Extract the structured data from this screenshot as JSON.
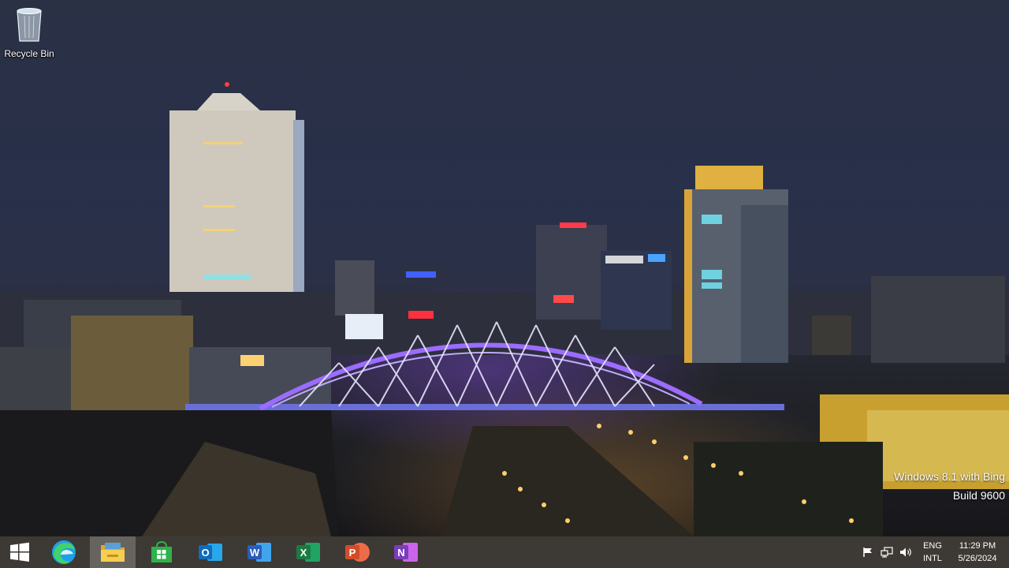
{
  "desktop": {
    "icons": [
      {
        "label": "Recycle Bin",
        "icon": "recycle-bin-icon"
      }
    ],
    "watermark": {
      "line1": "Windows 8.1 with Bing",
      "line2": "Build 9600"
    }
  },
  "taskbar": {
    "start": {
      "icon": "windows-logo-icon"
    },
    "apps": [
      {
        "name": "Microsoft Edge",
        "icon": "edge-icon",
        "color": "#1fa0e6"
      },
      {
        "name": "File Explorer",
        "icon": "file-explorer-icon",
        "color": "#f3c94a",
        "active": true
      },
      {
        "name": "Microsoft Store",
        "icon": "store-icon",
        "color": "#2eb24a"
      },
      {
        "name": "Outlook",
        "icon": "outlook-icon",
        "color": "#0f6cbd"
      },
      {
        "name": "Word",
        "icon": "word-icon",
        "color": "#2b5cb8"
      },
      {
        "name": "Excel",
        "icon": "excel-icon",
        "color": "#1d7a43"
      },
      {
        "name": "PowerPoint",
        "icon": "powerpoint-icon",
        "color": "#d04d2a"
      },
      {
        "name": "OneNote",
        "icon": "onenote-icon",
        "color": "#7b3dbb"
      }
    ],
    "app_letters": {
      "outlook": "O",
      "word": "W",
      "excel": "X",
      "powerpoint": "P",
      "onenote": "N"
    },
    "tray": {
      "icons": [
        "flag-icon",
        "network-icon",
        "volume-icon"
      ],
      "lang_top": "ENG",
      "lang_bottom": "INTL",
      "time": "11:29 PM",
      "date": "5/26/2024"
    }
  }
}
